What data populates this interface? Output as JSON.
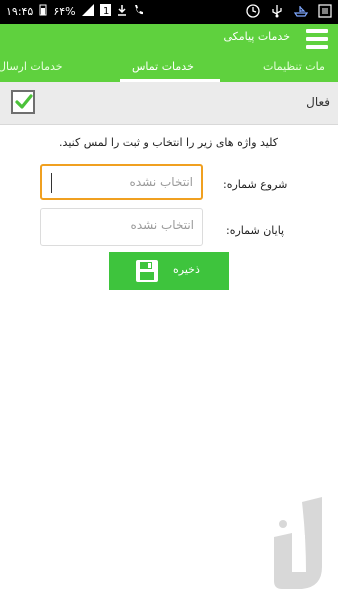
{
  "status_bar": {
    "time": "۱۹:۴۵",
    "battery": "۶۴%",
    "icons": [
      "battery-icon",
      "signal-icon",
      "notification-1-icon",
      "download-icon",
      "phone-icon",
      "clock-icon",
      "usb-icon",
      "boat-icon",
      "menu-icon"
    ]
  },
  "app_bar": {
    "title": "خدمات پیامکی"
  },
  "tabs": [
    {
      "label": "خدمات ارسال",
      "active": false
    },
    {
      "label": "خدمات تماس",
      "active": true
    },
    {
      "label": "مات تنظیمات",
      "active": false
    }
  ],
  "active_row": {
    "label": "فعال",
    "checked": true
  },
  "instruction": "کلید واژه های زیر را انتخاب و ثبت را لمس کنید.",
  "fields": {
    "start": {
      "label": "شروع شماره:",
      "placeholder": "انتخاب نشده"
    },
    "end": {
      "label": "پایان شماره:",
      "placeholder": "انتخاب نشده"
    }
  },
  "save_button": {
    "label": "ذخیره"
  },
  "colors": {
    "accent": "#5fd13e",
    "button": "#3ec43d",
    "focus": "#f0a020"
  }
}
